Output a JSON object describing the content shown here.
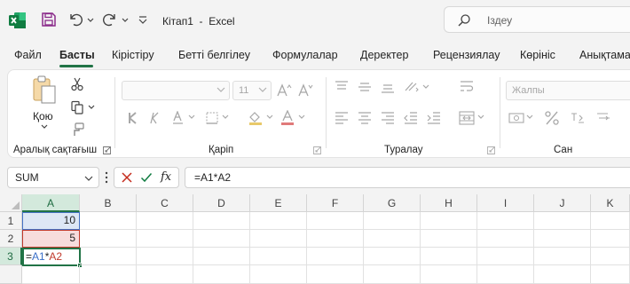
{
  "titlebar": {
    "title": "Кітап1  -  Excel",
    "search_placeholder": "Іздеу"
  },
  "tabs": [
    {
      "label": "Файл"
    },
    {
      "label": "Басты"
    },
    {
      "label": "Кірістіру"
    },
    {
      "label": "Бетті белгілеу"
    },
    {
      "label": "Формулалар"
    },
    {
      "label": "Деректер"
    },
    {
      "label": "Рецензиялау"
    },
    {
      "label": "Көрініс"
    },
    {
      "label": "Анықтама"
    }
  ],
  "ribbon": {
    "paste_label": "Қою",
    "groups": {
      "clipboard": "Аралық сақтағыш",
      "font": "Қаріп",
      "alignment": "Туралау",
      "number": "Сан"
    },
    "font_size": "11",
    "number_format": "Жалпы"
  },
  "formula_bar": {
    "name_box": "SUM",
    "fx": "fx",
    "formula": "=A1*A2"
  },
  "grid": {
    "columns": [
      "A",
      "B",
      "C",
      "D",
      "E",
      "F",
      "G",
      "H",
      "I",
      "J",
      "K"
    ],
    "rows": [
      "1",
      "2",
      "3"
    ],
    "cells": {
      "A1": "10",
      "A2": "5",
      "A3_eq": "=",
      "A3_ref1": "A1",
      "A3_op": "*",
      "A3_ref2": "A2"
    }
  },
  "colors": {
    "accent": "#217346",
    "ref1": "#4472c4",
    "ref2": "#c0392b"
  }
}
